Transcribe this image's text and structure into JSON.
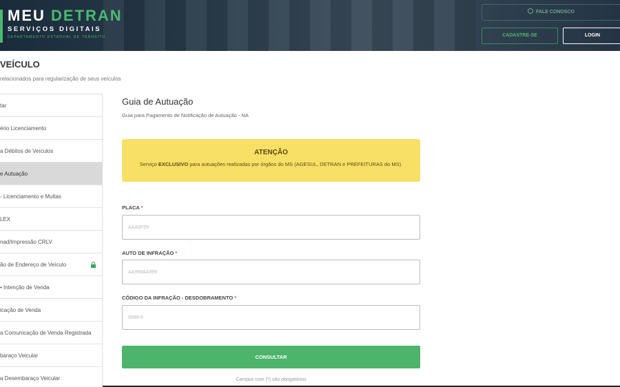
{
  "header": {
    "brand": {
      "part1": "MEU ",
      "part2": "DETRAN",
      "subtitle": "SERVIÇOS DIGITAIS",
      "department": "DEPARTAMENTO ESTADUAL DE TRÂNSITO"
    },
    "fale_conosco": "FALE CONOSCO",
    "cadastre": "CADASTRE-SE",
    "login": "LOGIN"
  },
  "page": {
    "title": "VEÍCULO",
    "subtitle": "relacionados para regularização de seus veículos"
  },
  "sidebar": {
    "items": [
      {
        "label": "tar"
      },
      {
        "label": "ério Licenciamento"
      },
      {
        "label": "a Débitos de Veículos"
      },
      {
        "label": "e Autuação",
        "active": true
      },
      {
        "label": "- Licenciamento e Multas"
      },
      {
        "label": "LEX"
      },
      {
        "label": "nad/Impressão CRLV"
      },
      {
        "label": "ão de Endereço de Veículo",
        "locked": true
      },
      {
        "label": "• Intenção de Venda"
      },
      {
        "label": "icação de Venda"
      },
      {
        "label": "a Comunicação de Venda Registrada"
      },
      {
        "label": "baraço Veicular"
      },
      {
        "label": "a Desembaraço Veicular"
      }
    ]
  },
  "main": {
    "title": "Guia de Autuação",
    "subtitle": "Guia para Pagamento de Notificação de Autuação - NA",
    "alert": {
      "title": "ATENÇÃO",
      "text_before": "Serviço ",
      "text_bold": "EXCLUSIVO",
      "text_after": " para autuações realizadas por órgãos do MS (AGESUL, DETRAN e PREFEITURAS do MS)."
    },
    "fields": {
      "placa": {
        "label": "PLACA",
        "required_mark": "*",
        "placeholder": "AAA9F99"
      },
      "auto": {
        "label": "AUTO DE INFRAÇÃO",
        "required_mark": "*",
        "placeholder": "AA999AA999"
      },
      "codigo": {
        "label": "CÓDIGO DA INFRAÇÃO - DESDOBRAMENTO",
        "required_mark": "*",
        "placeholder": "9999-9"
      }
    },
    "submit": "CONSULTAR",
    "footnote": "Campos com (*) são obrigatórios"
  },
  "colors": {
    "brand_green": "#4cb970",
    "alert_yellow": "#f8e067",
    "button_green": "#4cb46b",
    "active_item": "#d9d9d9"
  }
}
